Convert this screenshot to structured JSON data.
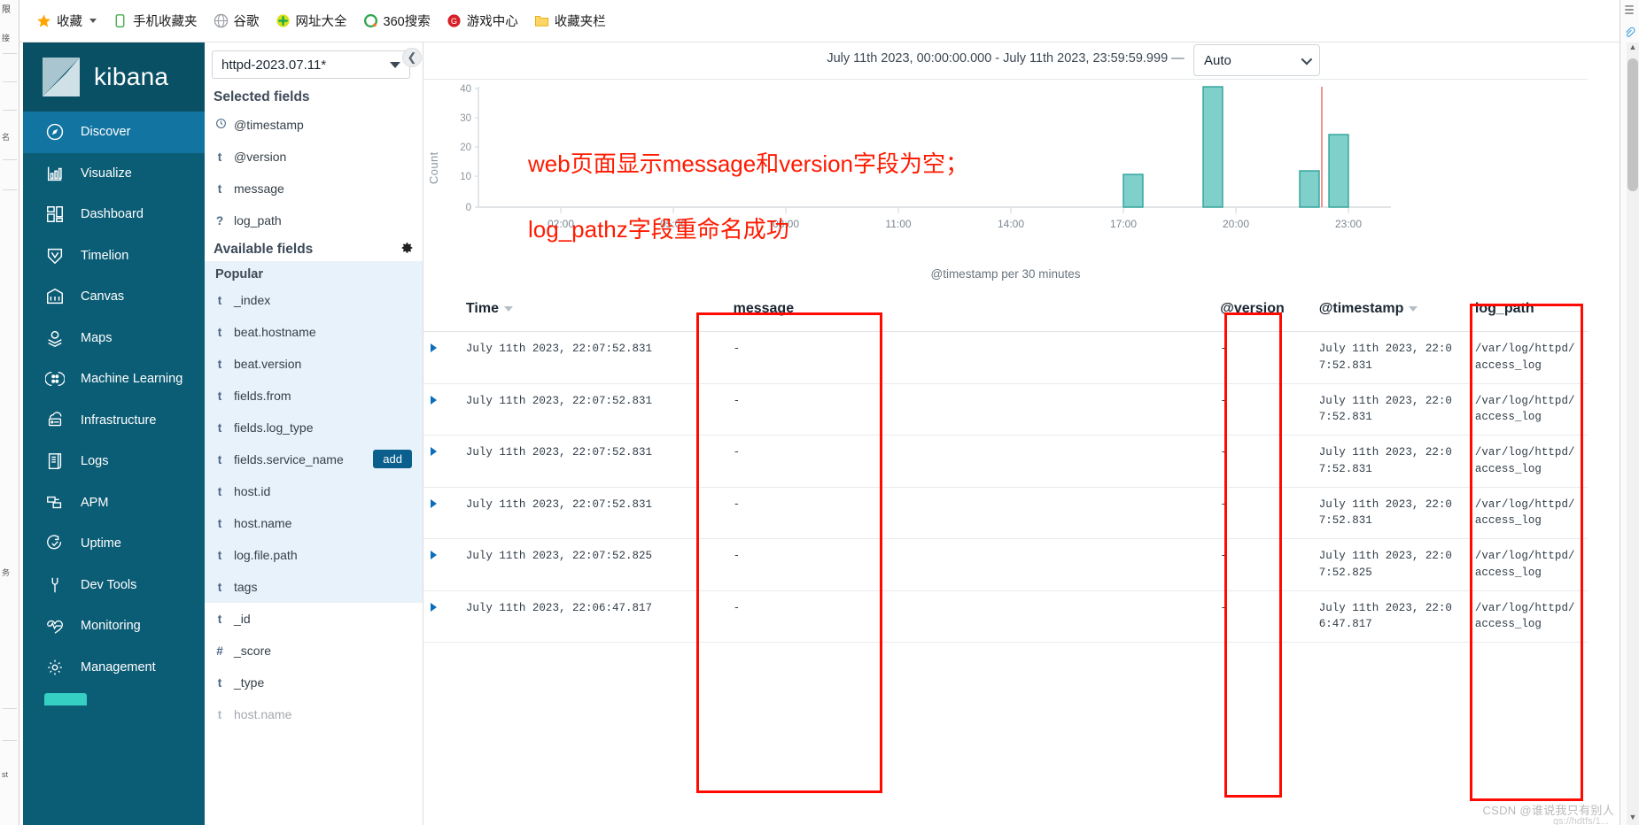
{
  "browser": {
    "bookmarks": [
      {
        "label": "收藏",
        "icon": "star-icon",
        "has_caret": true
      },
      {
        "label": "手机收藏夹",
        "icon": "phone-icon",
        "has_caret": false
      },
      {
        "label": "谷歌",
        "icon": "globe-icon",
        "has_caret": false
      },
      {
        "label": "网址大全",
        "icon": "plus-circle-icon",
        "has_caret": false
      },
      {
        "label": "360搜索",
        "icon": "o-circle-icon",
        "has_caret": false
      },
      {
        "label": "游戏中心",
        "icon": "g-circle-icon",
        "has_caret": false
      },
      {
        "label": "收藏夹栏",
        "icon": "folder-icon",
        "has_caret": false
      }
    ]
  },
  "sidebar": {
    "brand": "kibana",
    "items": [
      {
        "label": "Discover",
        "icon": "compass-icon",
        "active": true
      },
      {
        "label": "Visualize",
        "icon": "bar-chart-icon",
        "active": false
      },
      {
        "label": "Dashboard",
        "icon": "dashboard-grid-icon",
        "active": false
      },
      {
        "label": "Timelion",
        "icon": "timelion-icon",
        "active": false
      },
      {
        "label": "Canvas",
        "icon": "canvas-icon",
        "active": false
      },
      {
        "label": "Maps",
        "icon": "map-pin-icon",
        "active": false
      },
      {
        "label": "Machine Learning",
        "icon": "ml-nodes-icon",
        "active": false
      },
      {
        "label": "Infrastructure",
        "icon": "infrastructure-icon",
        "active": false
      },
      {
        "label": "Logs",
        "icon": "logs-icon",
        "active": false
      },
      {
        "label": "APM",
        "icon": "apm-icon",
        "active": false
      },
      {
        "label": "Uptime",
        "icon": "uptime-icon",
        "active": false
      },
      {
        "label": "Dev Tools",
        "icon": "wrench-icon",
        "active": false
      },
      {
        "label": "Monitoring",
        "icon": "heartbeat-icon",
        "active": false
      },
      {
        "label": "Management",
        "icon": "gear-icon",
        "active": false
      }
    ]
  },
  "field_panel": {
    "index_pattern": "httpd-2023.07.11*",
    "selected_fields_title": "Selected fields",
    "selected_fields": [
      {
        "type": "clock",
        "name": "@timestamp"
      },
      {
        "type": "t",
        "name": "@version"
      },
      {
        "type": "t",
        "name": "message"
      },
      {
        "type": "?",
        "name": "log_path"
      }
    ],
    "available_fields_title": "Available fields",
    "popular_label": "Popular",
    "popular_fields": [
      {
        "type": "t",
        "name": "_index"
      },
      {
        "type": "t",
        "name": "beat.hostname"
      },
      {
        "type": "t",
        "name": "beat.version"
      },
      {
        "type": "t",
        "name": "fields.from"
      },
      {
        "type": "t",
        "name": "fields.log_type"
      },
      {
        "type": "t",
        "name": "fields.service_name",
        "add_label": "add"
      },
      {
        "type": "t",
        "name": "host.id"
      },
      {
        "type": "t",
        "name": "host.name"
      },
      {
        "type": "t",
        "name": "log.file.path"
      },
      {
        "type": "t",
        "name": "tags"
      }
    ],
    "other_fields": [
      {
        "type": "t",
        "name": "_id"
      },
      {
        "type": "#",
        "name": "_score"
      },
      {
        "type": "t",
        "name": "_type"
      },
      {
        "type": "t",
        "name": "host.name"
      }
    ]
  },
  "toolbar": {
    "time_range": "July 11th 2023, 00:00:00.000 - July 11th 2023, 23:59:59.999",
    "time_range_dash": "—",
    "interval_value": "Auto",
    "collapse_icon": "chevron-left-icon"
  },
  "chart_data": {
    "type": "bar",
    "title": "",
    "xlabel": "@timestamp per 30 minutes",
    "ylabel": "Count",
    "ylim": [
      0,
      40
    ],
    "yticks": [
      0,
      10,
      20,
      30,
      40
    ],
    "xticks": [
      "02:00",
      "05:00",
      "08:00",
      "11:00",
      "14:00",
      "17:00",
      "20:00",
      "23:00"
    ],
    "grid": false,
    "bar_color": "#6eccc6",
    "bar_border": "#2f9e95",
    "categories": [
      "17:00",
      "19:00",
      "22:00",
      "22:40"
    ],
    "values": [
      11,
      39,
      12,
      22
    ],
    "marker_line": {
      "x": "22:30",
      "color": "#e8736c"
    }
  },
  "annotation": {
    "line1": "web页面显示message和version字段为空；",
    "line2": "log_pathz字段重命名成功",
    "color": "#ff1a00"
  },
  "table": {
    "columns": [
      {
        "key": "toggle",
        "label": ""
      },
      {
        "key": "time",
        "label": "Time",
        "sortable": true
      },
      {
        "key": "message",
        "label": "message"
      },
      {
        "key": "version",
        "label": "@version"
      },
      {
        "key": "timestamp",
        "label": "@timestamp",
        "sortable": true
      },
      {
        "key": "log_path",
        "label": "log_path"
      }
    ],
    "rows": [
      {
        "time": "July 11th 2023, 22:07:52.831",
        "message": "-",
        "version": "-",
        "timestamp": "July 11th 2023, 22:07:52.831",
        "log_path": "/var/log/httpd/access_log"
      },
      {
        "time": "July 11th 2023, 22:07:52.831",
        "message": "-",
        "version": "-",
        "timestamp": "July 11th 2023, 22:07:52.831",
        "log_path": "/var/log/httpd/access_log"
      },
      {
        "time": "July 11th 2023, 22:07:52.831",
        "message": "-",
        "version": "-",
        "timestamp": "July 11th 2023, 22:07:52.831",
        "log_path": "/var/log/httpd/access_log"
      },
      {
        "time": "July 11th 2023, 22:07:52.831",
        "message": "-",
        "version": "-",
        "timestamp": "July 11th 2023, 22:07:52.831",
        "log_path": "/var/log/httpd/access_log"
      },
      {
        "time": "July 11th 2023, 22:07:52.825",
        "message": "-",
        "version": "-",
        "timestamp": "July 11th 2023, 22:07:52.825",
        "log_path": "/var/log/httpd/access_log"
      },
      {
        "time": "July 11th 2023, 22:06:47.817",
        "message": "-",
        "version": "-",
        "timestamp": "July 11th 2023, 22:06:47.817",
        "log_path": "/var/log/httpd/access_log"
      }
    ]
  },
  "watermark": {
    "text": "CSDN @谁说我只有别人",
    "sub": "gs://hdtfs/1..."
  }
}
